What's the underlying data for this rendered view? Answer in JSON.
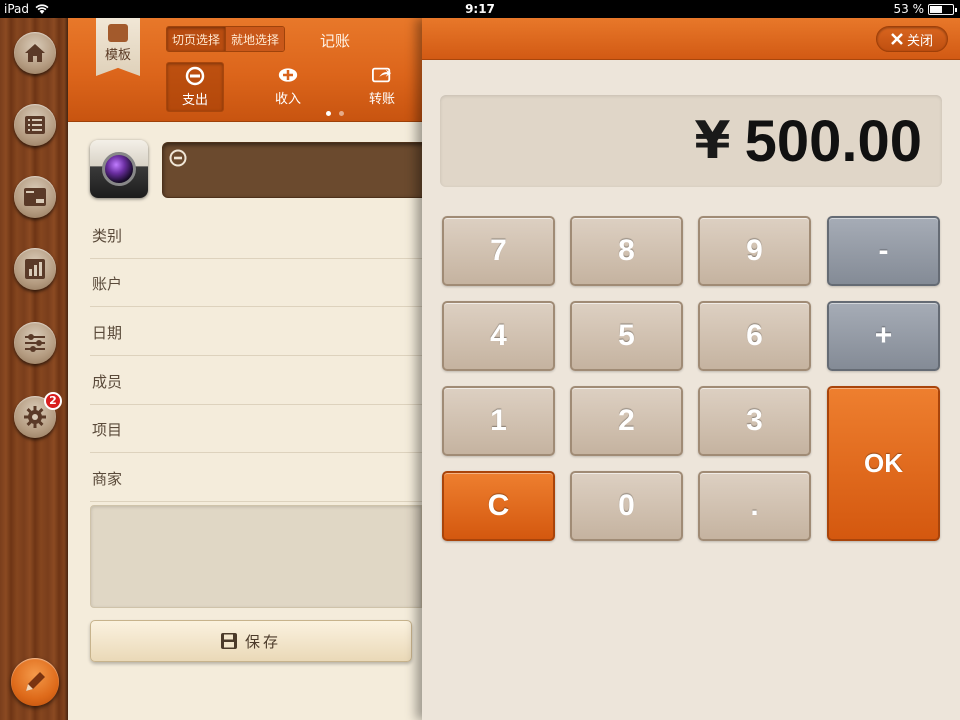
{
  "status_bar": {
    "device": "iPad",
    "time": "9:17",
    "battery": "53 %",
    "battery_level": 0.53
  },
  "sidebar": {
    "items": [
      {
        "name": "home-icon"
      },
      {
        "name": "list-icon"
      },
      {
        "name": "wallet-icon"
      },
      {
        "name": "report-icon"
      },
      {
        "name": "sliders-icon"
      },
      {
        "name": "settings-icon",
        "badge": "2"
      }
    ],
    "compose_icon": "pencil-icon"
  },
  "form": {
    "template_label": "模板",
    "segment": {
      "option_a": "切页选择",
      "option_b": "就地选择"
    },
    "title": "记账",
    "tabs": [
      {
        "label": "支出",
        "icon": "minus-circle-icon"
      },
      {
        "label": "收入",
        "icon": "plus-circle-icon"
      },
      {
        "label": "转账",
        "icon": "transfer-icon"
      }
    ],
    "fields": [
      "类别",
      "账户",
      "日期",
      "成员",
      "项目",
      "商家"
    ],
    "save_label": "保存"
  },
  "calculator": {
    "close_label": "关闭",
    "currency": "¥",
    "display_value": "500.00",
    "keys": {
      "k7": "7",
      "k8": "8",
      "k9": "9",
      "minus": "-",
      "k4": "4",
      "k5": "5",
      "k6": "6",
      "plus": "+",
      "k1": "1",
      "k2": "2",
      "k3": "3",
      "ok": "OK",
      "clear": "C",
      "k0": "0",
      "dot": "."
    }
  },
  "colors": {
    "accent_orange": "#dc651b",
    "wood": "#7a3e1c",
    "paper": "#f4ecdb",
    "key_beige": "#c5b3a0",
    "key_gray": "#848b96"
  }
}
